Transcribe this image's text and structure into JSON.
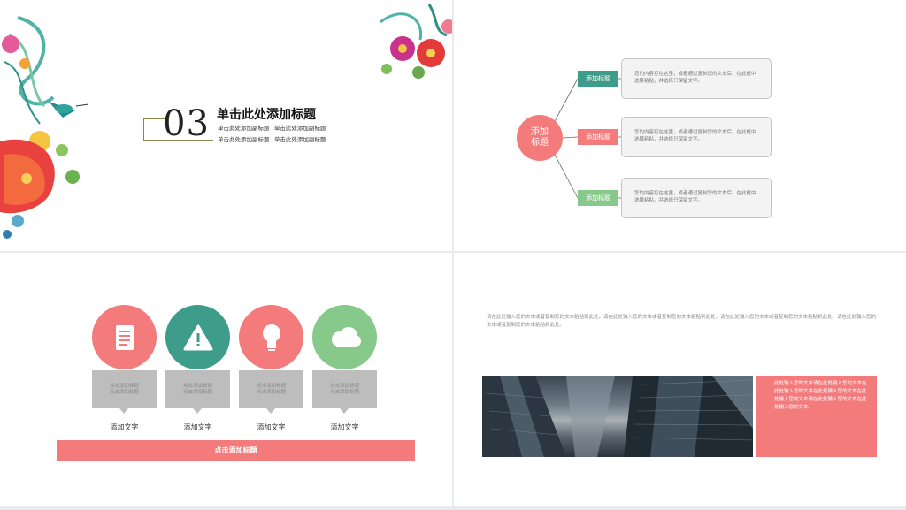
{
  "colors": {
    "pink": "#f47b7b",
    "teal": "#3d9c8a",
    "green": "#86c98a",
    "gray": "#bdbdbd"
  },
  "slide1": {
    "number": "03",
    "title": "单击此处添加标题",
    "sub_left_1": "单击此处添加副标题",
    "sub_right_1": "单击此处添加副标题",
    "sub_2": "单击此处添加副标题",
    "sub_3": "单击此处添加副标题"
  },
  "slide2": {
    "hub_line1": "添加",
    "hub_line2": "标题",
    "items": [
      {
        "tag": "添加标题",
        "color": "#3d9c8a",
        "text": "您的内容打在这里，或者通过复制您的文本后，在此框中选择粘贴，并选择只保留文字。"
      },
      {
        "tag": "添加标题",
        "color": "#f47b7b",
        "text": "您的内容打在这里，或者通过复制您的文本后，在此框中选择粘贴，并选择只保留文字。"
      },
      {
        "tag": "添加标题",
        "color": "#86c98a",
        "text": "您的内容打在这里，或者通过复制您的文本后，在此框中选择粘贴，并选择只保留文字。"
      }
    ]
  },
  "slide3": {
    "items": [
      {
        "icon": "document-icon",
        "color": "#f47b7b",
        "card_line1": "点击添加标题",
        "card_line2": "点击添加标题",
        "caption": "添加文字"
      },
      {
        "icon": "warning-icon",
        "color": "#3d9c8a",
        "card_line1": "点击添加标题",
        "card_line2": "点击添加标题",
        "caption": "添加文字"
      },
      {
        "icon": "lightbulb-icon",
        "color": "#f47b7b",
        "card_line1": "点击添加标题",
        "card_line2": "点击添加标题",
        "caption": "添加文字"
      },
      {
        "icon": "cloud-icon",
        "color": "#86c98a",
        "card_line1": "点击添加标题",
        "card_line2": "点击添加标题",
        "caption": "添加文字"
      }
    ],
    "bar_label": "点击添加标题"
  },
  "slide4": {
    "paragraph": "请在此处输入您的文本或者复制您的文本粘贴到此处，请在此处输入您的文本或者复制您的文本粘贴到此处，请在此处输入您的文本或者复制您的文本粘贴到此处，请在此处输入您的文本或者复制您的文本粘贴到此处。",
    "box_text": "此处输入您的文本请在此处输入您的文本在此处输入您的文本在此处输入您的文本在此处输入您的文本请在此处输入您的文本在此处输入您的文本。"
  }
}
